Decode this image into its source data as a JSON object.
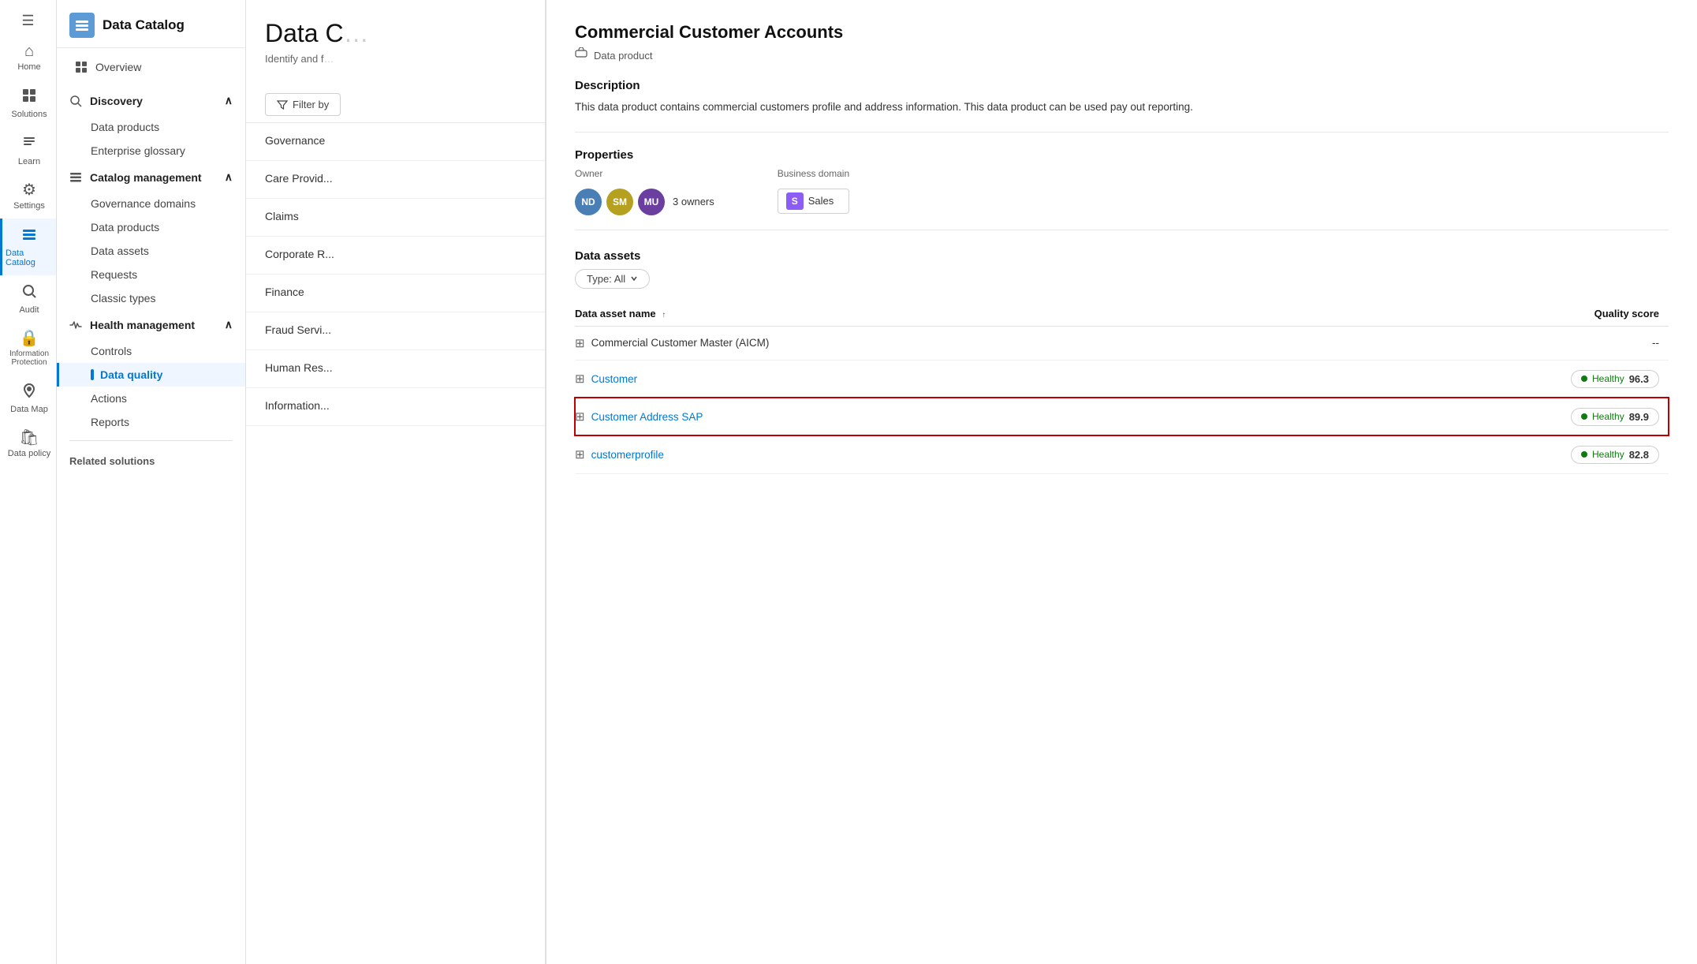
{
  "iconNav": {
    "items": [
      {
        "id": "home",
        "label": "Home",
        "icon": "⌂",
        "active": false
      },
      {
        "id": "solutions",
        "label": "Solutions",
        "icon": "⊞",
        "active": false
      },
      {
        "id": "learn",
        "label": "Learn",
        "icon": "📖",
        "active": false
      },
      {
        "id": "settings",
        "label": "Settings",
        "icon": "⚙",
        "active": false
      },
      {
        "id": "data-catalog",
        "label": "Data Catalog",
        "icon": "🗄",
        "active": true
      },
      {
        "id": "audit",
        "label": "Audit",
        "icon": "🔍",
        "active": false
      },
      {
        "id": "information-protection",
        "label": "Information Protection",
        "icon": "🔒",
        "active": false
      },
      {
        "id": "data-map",
        "label": "Data Map",
        "icon": "🗺",
        "active": false
      },
      {
        "id": "data-policy",
        "label": "Data policy",
        "icon": "🛍",
        "active": false
      }
    ]
  },
  "sidebar": {
    "headerTitle": "Data Catalog",
    "overviewLabel": "Overview",
    "groups": [
      {
        "id": "discovery",
        "label": "Discovery",
        "expanded": true,
        "icon": "🔍",
        "items": [
          {
            "id": "data-products-discovery",
            "label": "Data products"
          },
          {
            "id": "enterprise-glossary",
            "label": "Enterprise glossary"
          }
        ]
      },
      {
        "id": "catalog-management",
        "label": "Catalog management",
        "expanded": true,
        "icon": "📋",
        "items": [
          {
            "id": "governance-domains",
            "label": "Governance domains"
          },
          {
            "id": "data-products-catalog",
            "label": "Data products"
          },
          {
            "id": "data-assets",
            "label": "Data assets"
          },
          {
            "id": "requests",
            "label": "Requests"
          },
          {
            "id": "classic-types",
            "label": "Classic types"
          }
        ]
      },
      {
        "id": "health-management",
        "label": "Health management",
        "expanded": true,
        "icon": "💊",
        "items": [
          {
            "id": "controls",
            "label": "Controls"
          },
          {
            "id": "data-quality",
            "label": "Data quality",
            "active": true
          },
          {
            "id": "actions",
            "label": "Actions"
          },
          {
            "id": "reports",
            "label": "Reports"
          }
        ]
      }
    ],
    "relatedSolutionsLabel": "Related solutions"
  },
  "listPanel": {
    "title": "Data C",
    "subtitle": "Identify and f",
    "filterLabel": "Filter by",
    "tabs": [
      {
        "id": "governance",
        "label": "Governance",
        "active": false
      },
      {
        "id": "care-provider",
        "label": "Care Provid...",
        "active": false
      },
      {
        "id": "claims",
        "label": "Claims",
        "active": false
      },
      {
        "id": "corporate",
        "label": "Corporate R...",
        "active": false
      },
      {
        "id": "finance",
        "label": "Finance",
        "active": false
      },
      {
        "id": "fraud",
        "label": "Fraud Servi...",
        "active": false
      },
      {
        "id": "human-resources",
        "label": "Human Res...",
        "active": false
      },
      {
        "id": "information",
        "label": "Information...",
        "active": false
      }
    ]
  },
  "detail": {
    "title": "Commercial Customer Accounts",
    "typeLabel": "Data product",
    "descriptionHeader": "Description",
    "descriptionText": "This data product contains commercial customers profile and address information. This data product can be used pay out reporting.",
    "propertiesHeader": "Properties",
    "ownerLabel": "Owner",
    "owners": [
      {
        "initials": "ND",
        "color": "#4a7fb5"
      },
      {
        "initials": "SM",
        "color": "#b5a020"
      },
      {
        "initials": "MU",
        "color": "#6b3fa0"
      }
    ],
    "ownersCountText": "3 owners",
    "businessDomainLabel": "Business domain",
    "businessDomainLetter": "S",
    "businessDomainName": "Sales",
    "dataAssetsHeader": "Data assets",
    "typeFilterLabel": "Type: All",
    "tableHeaders": {
      "name": "Data asset name",
      "qualityScore": "Quality score"
    },
    "assets": [
      {
        "id": "commercial-master",
        "name": "Commercial Customer Master (AICM)",
        "isLink": false,
        "qualityScore": "--",
        "isHealthy": false,
        "selected": false
      },
      {
        "id": "customer",
        "name": "Customer",
        "isLink": true,
        "qualityScore": "96.3",
        "isHealthy": true,
        "healthyLabel": "Healthy",
        "selected": false
      },
      {
        "id": "customer-address-sap",
        "name": "Customer Address SAP",
        "isLink": true,
        "qualityScore": "89.9",
        "isHealthy": true,
        "healthyLabel": "Healthy",
        "selected": true
      },
      {
        "id": "customerprofile",
        "name": "customerprofile",
        "isLink": true,
        "qualityScore": "82.8",
        "isHealthy": true,
        "healthyLabel": "Healthy",
        "selected": false
      }
    ]
  }
}
